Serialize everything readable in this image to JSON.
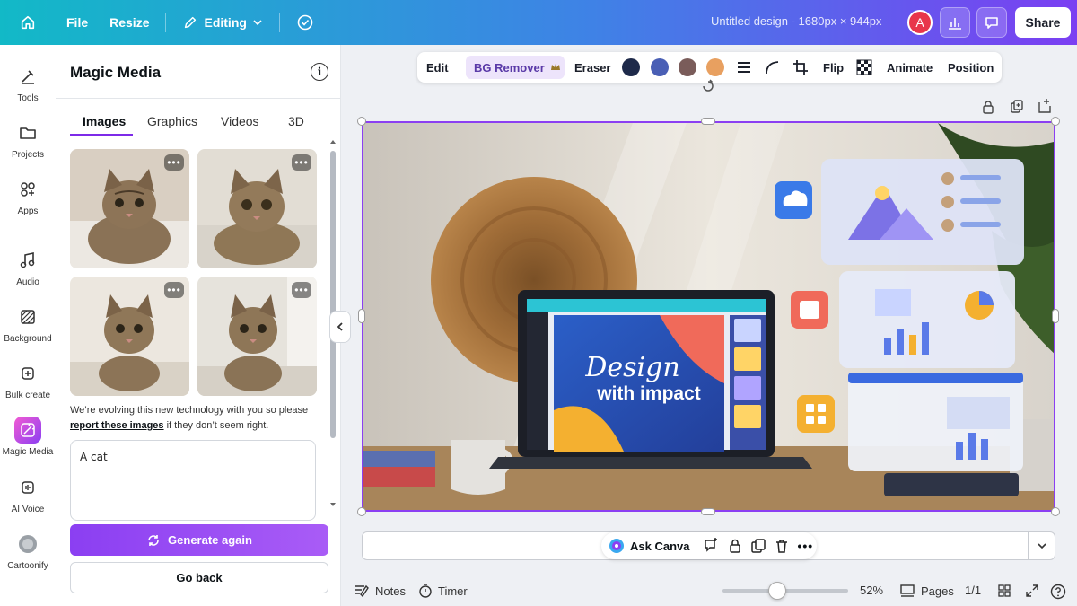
{
  "topbar": {
    "file": "File",
    "resize": "Resize",
    "editing": "Editing",
    "title": "Untitled design - 1680px × 944px",
    "avatar_initial": "A",
    "share": "Share"
  },
  "rail": {
    "items": [
      {
        "label": "Tools",
        "icon": "tools-icon"
      },
      {
        "label": "Projects",
        "icon": "folder-icon"
      },
      {
        "label": "Apps",
        "icon": "apps-icon"
      },
      {
        "label": "Audio",
        "icon": "music-note-icon"
      },
      {
        "label": "Background",
        "icon": "background-icon"
      },
      {
        "label": "Bulk create",
        "icon": "bulk-create-icon"
      },
      {
        "label": "Magic Media",
        "icon": "magic-media-icon"
      },
      {
        "label": "AI Voice",
        "icon": "ai-voice-icon"
      },
      {
        "label": "Cartoonify",
        "icon": "cartoonify-icon"
      }
    ]
  },
  "panel": {
    "title": "Magic Media",
    "tabs": [
      "Images",
      "Graphics",
      "Videos",
      "3D"
    ],
    "notice_pre": "We’re evolving this new technology with you so please",
    "notice_link": "report these images",
    "notice_post": "if they don’t seem right.",
    "prompt": "A cat",
    "generate": "Generate again",
    "go_back": "Go back"
  },
  "context_toolbar": {
    "edit": "Edit",
    "bg_remover": "BG Remover",
    "eraser": "Eraser",
    "flip": "Flip",
    "animate": "Animate",
    "position": "Position",
    "colors": [
      "#1e2a4a",
      "#4a5fb5",
      "#7a5c5a",
      "#e8a060"
    ]
  },
  "canvas": {
    "screen_line1": "Design",
    "screen_line2": "with impact"
  },
  "bottom": {
    "ask": "Ask Canva",
    "notes": "Notes",
    "timer": "Timer",
    "zoom": "52%",
    "pages": "Pages",
    "page_count": "1/1"
  },
  "colors": {
    "accent": "#8b3ff2",
    "top_gradient_start": "#12b9c7",
    "top_gradient_end": "#7b3ff2"
  }
}
